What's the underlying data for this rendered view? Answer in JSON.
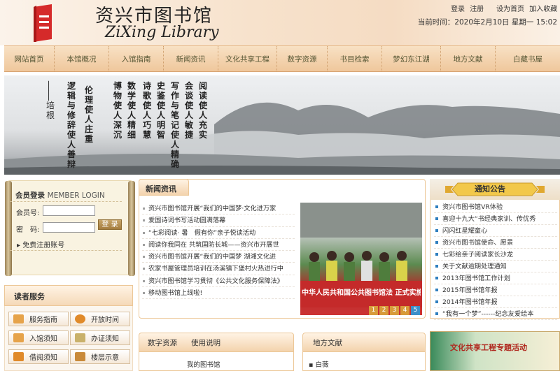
{
  "header": {
    "logo_cn": "资兴市图书馆",
    "logo_en": "ZiXing Library",
    "links": [
      "登录",
      "注册"
    ],
    "links2": [
      "设为首页",
      "加入收藏"
    ],
    "datetime": "当前时间：2020年2月10日 星期一 15:02"
  },
  "nav": [
    "网站首页",
    "本馆概况",
    "入馆指南",
    "新闻资讯",
    "文化共享工程",
    "数字资源",
    "书目检索",
    "梦幻东江湖",
    "地方文献",
    "白藏书屋"
  ],
  "banner": {
    "poem_cols": [
      "阅读使人充实",
      "会谈使人敏捷",
      "写作与笔记使人精确",
      "史鉴使人明智",
      "诗歌使人巧慧",
      "数学使人精细",
      "博物使人深沉",
      "伦理使人庄重",
      "逻辑与修辞使人善辩"
    ],
    "poem_author": "培根"
  },
  "login": {
    "title": "会员登录",
    "title_en": "MEMBER LOGIN",
    "user_label": "会员号:",
    "pass_label": "密　码:",
    "button": "登 录",
    "register": "▸ 免费注册账号"
  },
  "services": {
    "title": "读者服务",
    "items": [
      "服务指南",
      "开放时间",
      "入馆须知",
      "办证须知",
      "借阅须知",
      "楼层示意"
    ]
  },
  "news": {
    "title": "新闻资讯",
    "items": [
      "资兴市图书馆开展“我们的中国梦·文化进万家",
      "爱国诗词书写活动圆满落幕",
      "“七彩阅读· 暑　假有你”亲子悦读活动",
      "阅读你我同在 共筑国防长城——资兴市开展世",
      "资兴市图书馆开展“我们的中国梦 湖湘文化进",
      "农家书屋管理员培训在汤溪镇下堡村火热进行中",
      "资兴市图书馆学习贯彻《公共文化服务保障法》",
      "移动图书馆上线啦!"
    ],
    "pages": [
      "1",
      "2",
      "3",
      "4",
      "5"
    ],
    "photo_banner": "中华人民共和国公共图书馆法 正式实施"
  },
  "notice": {
    "title": "通知公告",
    "items": [
      "资兴市图书馆VR体验",
      "喜迎十九大“书经典家训、传优秀",
      "闪闪红星耀童心",
      "资兴市图书馆使命、愿景",
      "七彩绘亲子阅读家长沙龙",
      "关于文献逾期处理通知",
      "2013年图书馆工作计划",
      "2015年图书馆年报",
      "2014年图书馆年报",
      "“我有一个梦”------纪念友爱绘本"
    ]
  },
  "digital": {
    "title": "数字资源",
    "subtitle": "使用说明",
    "first_item": "我的图书馆"
  },
  "local": {
    "title": "地方文献",
    "first_item": "白薇"
  },
  "culture_banner": "文化共享工程专题活动"
}
